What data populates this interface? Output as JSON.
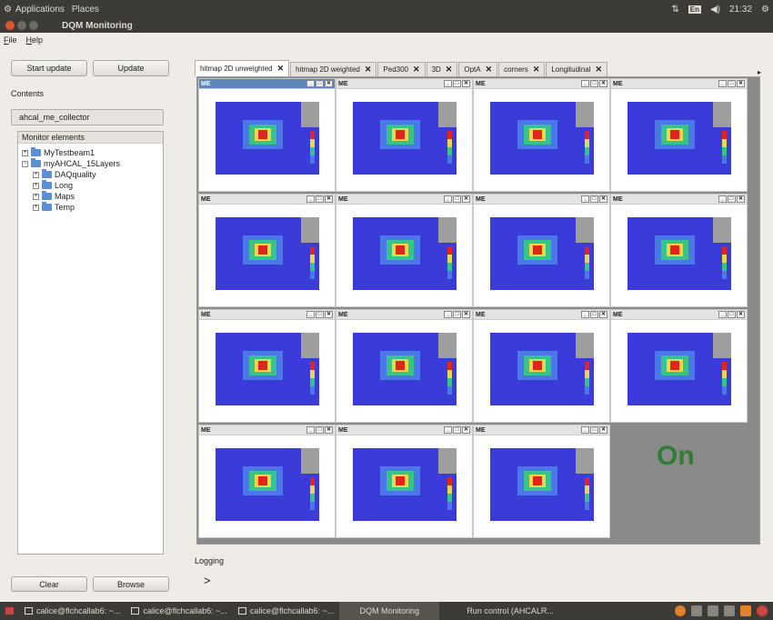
{
  "topbar": {
    "applications": "Applications",
    "places": "Places",
    "clock": "21:32",
    "lang": "En"
  },
  "window": {
    "title": "DQM Monitoring"
  },
  "menu": {
    "file": "File",
    "help": "Help"
  },
  "left": {
    "start_update": "Start update",
    "update": "Update",
    "contents_label": "Contents",
    "collector": "ahcal_me_collector",
    "monitor_elements": "Monitor elements",
    "tree": [
      "MyTestbeam1",
      "myAHCAL_15Layers",
      "DAQquality",
      "Long",
      "Maps",
      "Temp"
    ],
    "clear": "Clear",
    "browse": "Browse"
  },
  "tabs": [
    "hitmap 2D unweighted",
    "hitmap 2D weighted",
    "Ped300",
    "3D",
    "OptA",
    "corners",
    "Longitudinal"
  ],
  "canvas_label": "ME",
  "status": "On",
  "logging": {
    "label": "Logging",
    "prompt": ">"
  },
  "taskbar": {
    "items": [
      "calice@flchcallab6: ~...",
      "calice@flchcallab6: ~...",
      "calice@flchcallab6: ~...",
      "DQM Monitoring",
      "Run control (AHCALR..."
    ]
  },
  "colors": {
    "plot_bg": "#3b3bd9",
    "hot": "#e0261c",
    "warm": "#e8d84a",
    "mid": "#37c48a",
    "cool": "#4a78e8",
    "status_on": "#2e7d32"
  }
}
